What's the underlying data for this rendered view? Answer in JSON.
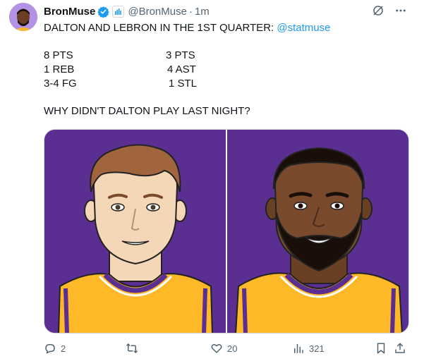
{
  "tweet": {
    "display_name": "BronMuse",
    "handle": "@BronMuse",
    "separator": "·",
    "time": "1m",
    "text": "DALTON AND LEBRON IN THE 1ST QUARTER: ",
    "mention": "@statmuse",
    "dalton_stats": [
      "8 PTS",
      "1 REB",
      "3-4 FG"
    ],
    "lebron_stats": [
      "3 PTS",
      "4 AST",
      "1 STL"
    ],
    "question": "WHY DIDN'T DALTON PLAY LAST NIGHT?"
  },
  "actions": {
    "replies": "2",
    "retweets": "",
    "likes": "20",
    "views": "321"
  },
  "colors": {
    "panel_purple": "#5b2f91",
    "jersey_gold": "#fdb927",
    "link_blue": "#1d9bf0",
    "muted": "#536471"
  }
}
